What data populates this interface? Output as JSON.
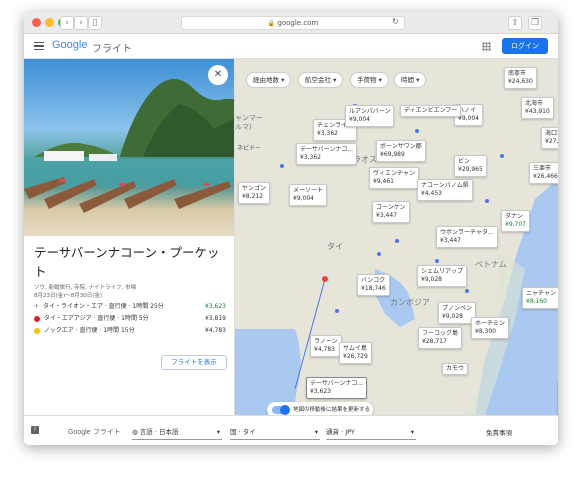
{
  "browser": {
    "url": "google.com"
  },
  "header": {
    "brand": "Google",
    "product": "フライト",
    "login": "ログイン"
  },
  "panel": {
    "title": "テーサバーンナコーン・プーケット",
    "tags": "ゾウ, 新婚旅行, 寺院, ナイトライフ, 市場",
    "dates": "8月23日(金)～8月30日(金)",
    "flights": [
      {
        "text": "タイ・ライオン・エア · 直行便 · 1時間 25分",
        "price": "¥3,623",
        "green": true,
        "icon": "airplane-icon"
      },
      {
        "text": "タイ・エアアジア · 直行便 · 1時間 5分",
        "price": "¥3,819",
        "green": false,
        "icon": "airasia-logo"
      },
      {
        "text": "ノックエア · 直行便 · 1時間 15分",
        "price": "¥4,783",
        "green": false,
        "icon": "nokair-logo"
      }
    ],
    "show_flights": "フライトを表示"
  },
  "filters": [
    "経由地数",
    "航空会社",
    "手荷物",
    "時間"
  ],
  "map": {
    "labels": [
      "ラオス",
      "タイ",
      "カンボジア",
      "ベトナム",
      "ャンマー",
      "ルマ)",
      "ネピドー",
      "ヤンゴン"
    ],
    "toggle": "地図の移動後に結果を更新する",
    "copyright": "地図データ ©2019 Google, SK telecom  利用規約",
    "pins": [
      {
        "city": "チェンライ県",
        "price": "¥3,362"
      },
      {
        "city": "テーサバーンナコ...",
        "price": "¥3,362"
      },
      {
        "city": "メーソート",
        "price": "¥9,004"
      },
      {
        "city": "ヤンゴン",
        "price": "¥8,212"
      },
      {
        "city": "ルアンパバーン",
        "price": "¥9,004"
      },
      {
        "city": "ボーンサワン郡",
        "price": "¥69,989"
      },
      {
        "city": "ヴィエンチャン",
        "price": "¥9,461"
      },
      {
        "city": "コーンケン",
        "price": "¥3,447"
      },
      {
        "city": "ナコーンパノム県",
        "price": "¥4,453"
      },
      {
        "city": "ウボンラーチャタ...",
        "price": "¥3,447"
      },
      {
        "city": "バンコク",
        "price": "¥18,746"
      },
      {
        "city": "シェムリアップ",
        "price": "¥9,028"
      },
      {
        "city": "プノンペン",
        "price": "¥9,028"
      },
      {
        "city": "フーコック島",
        "price": "¥28,717"
      },
      {
        "city": "ホーチミン",
        "price": "¥8,300"
      },
      {
        "city": "ニャチャン",
        "price": "¥8,160"
      },
      {
        "city": "ダナン",
        "price": "¥9,707"
      },
      {
        "city": "ハノイ",
        "price": "¥9,004"
      },
      {
        "city": "ビン",
        "price": "¥29,965"
      },
      {
        "city": "ディエンビエンフー",
        "price": ""
      },
      {
        "city": "ラノーン",
        "price": "¥4,783"
      },
      {
        "city": "サムイ島",
        "price": "¥26,729"
      },
      {
        "city": "テーサバーンナコ...",
        "price": "¥3,623"
      },
      {
        "city": "カモウ",
        "price": ""
      },
      {
        "city": "南寧市",
        "price": "¥24,630"
      },
      {
        "city": "北海市",
        "price": "¥43,910"
      },
      {
        "city": "海口市",
        "price": "¥27,187"
      },
      {
        "city": "三亜市",
        "price": "¥26,466"
      }
    ]
  },
  "footer": {
    "brand": "Google",
    "product": "フライト",
    "language": "言語 · 日本語",
    "country": "国 · タイ",
    "currency": "通貨 · JPY",
    "disclaimer": "免責事項"
  }
}
